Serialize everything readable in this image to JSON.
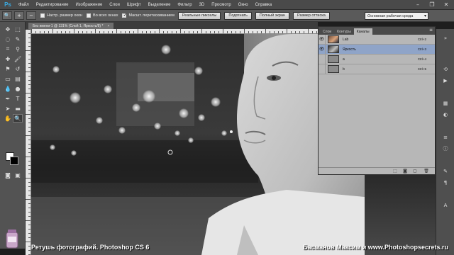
{
  "app": {
    "logo": "Ps",
    "menu": [
      "Файл",
      "Редактирование",
      "Изображение",
      "Слои",
      "Шрифт",
      "Выделение",
      "Фильтр",
      "3D",
      "Просмотр",
      "Окно",
      "Справка"
    ],
    "window_controls": [
      "minimize-icon",
      "restore-icon",
      "close-icon"
    ]
  },
  "options_bar": {
    "checkboxes": [
      {
        "label": "Настр. размер окон",
        "checked": false
      },
      {
        "label": "Во всех окнах",
        "checked": false
      },
      {
        "label": "Масшт. перетаскиванием",
        "checked": true
      }
    ],
    "buttons": [
      "Реальные пикселы",
      "Подогнать",
      "Полный экран",
      "Размер оттиска"
    ],
    "workspace": "Основная рабочая среда"
  },
  "document": {
    "tab_title": "Без имени-1 @ 131% (Слой 1, Яркость/8) *",
    "close": "×",
    "zoom": "131%"
  },
  "panel": {
    "tabs": [
      "Слои",
      "Контуры",
      "Каналы"
    ],
    "active_tab": "Каналы",
    "channels": [
      {
        "name": "Lab",
        "shortcut": "Ctrl+2",
        "visible": true,
        "selected": false,
        "thumb": "color"
      },
      {
        "name": "Яркость",
        "shortcut": "Ctrl+3",
        "visible": true,
        "selected": true,
        "thumb": "gray"
      },
      {
        "name": "a",
        "shortcut": "Ctrl+4",
        "visible": false,
        "selected": false,
        "thumb": "flat"
      },
      {
        "name": "b",
        "shortcut": "Ctrl+5",
        "visible": false,
        "selected": false,
        "thumb": "flat"
      }
    ]
  },
  "captions": {
    "left": "Ретушь фотографий. Photoshop CS 6",
    "right": "Басманов Максим и www.Photoshopsecrets.ru"
  },
  "colors": {
    "foreground": "#ffffff",
    "background": "#000000",
    "selected_row": "#8fa4c8",
    "ps_blue": "#39a9e0"
  }
}
